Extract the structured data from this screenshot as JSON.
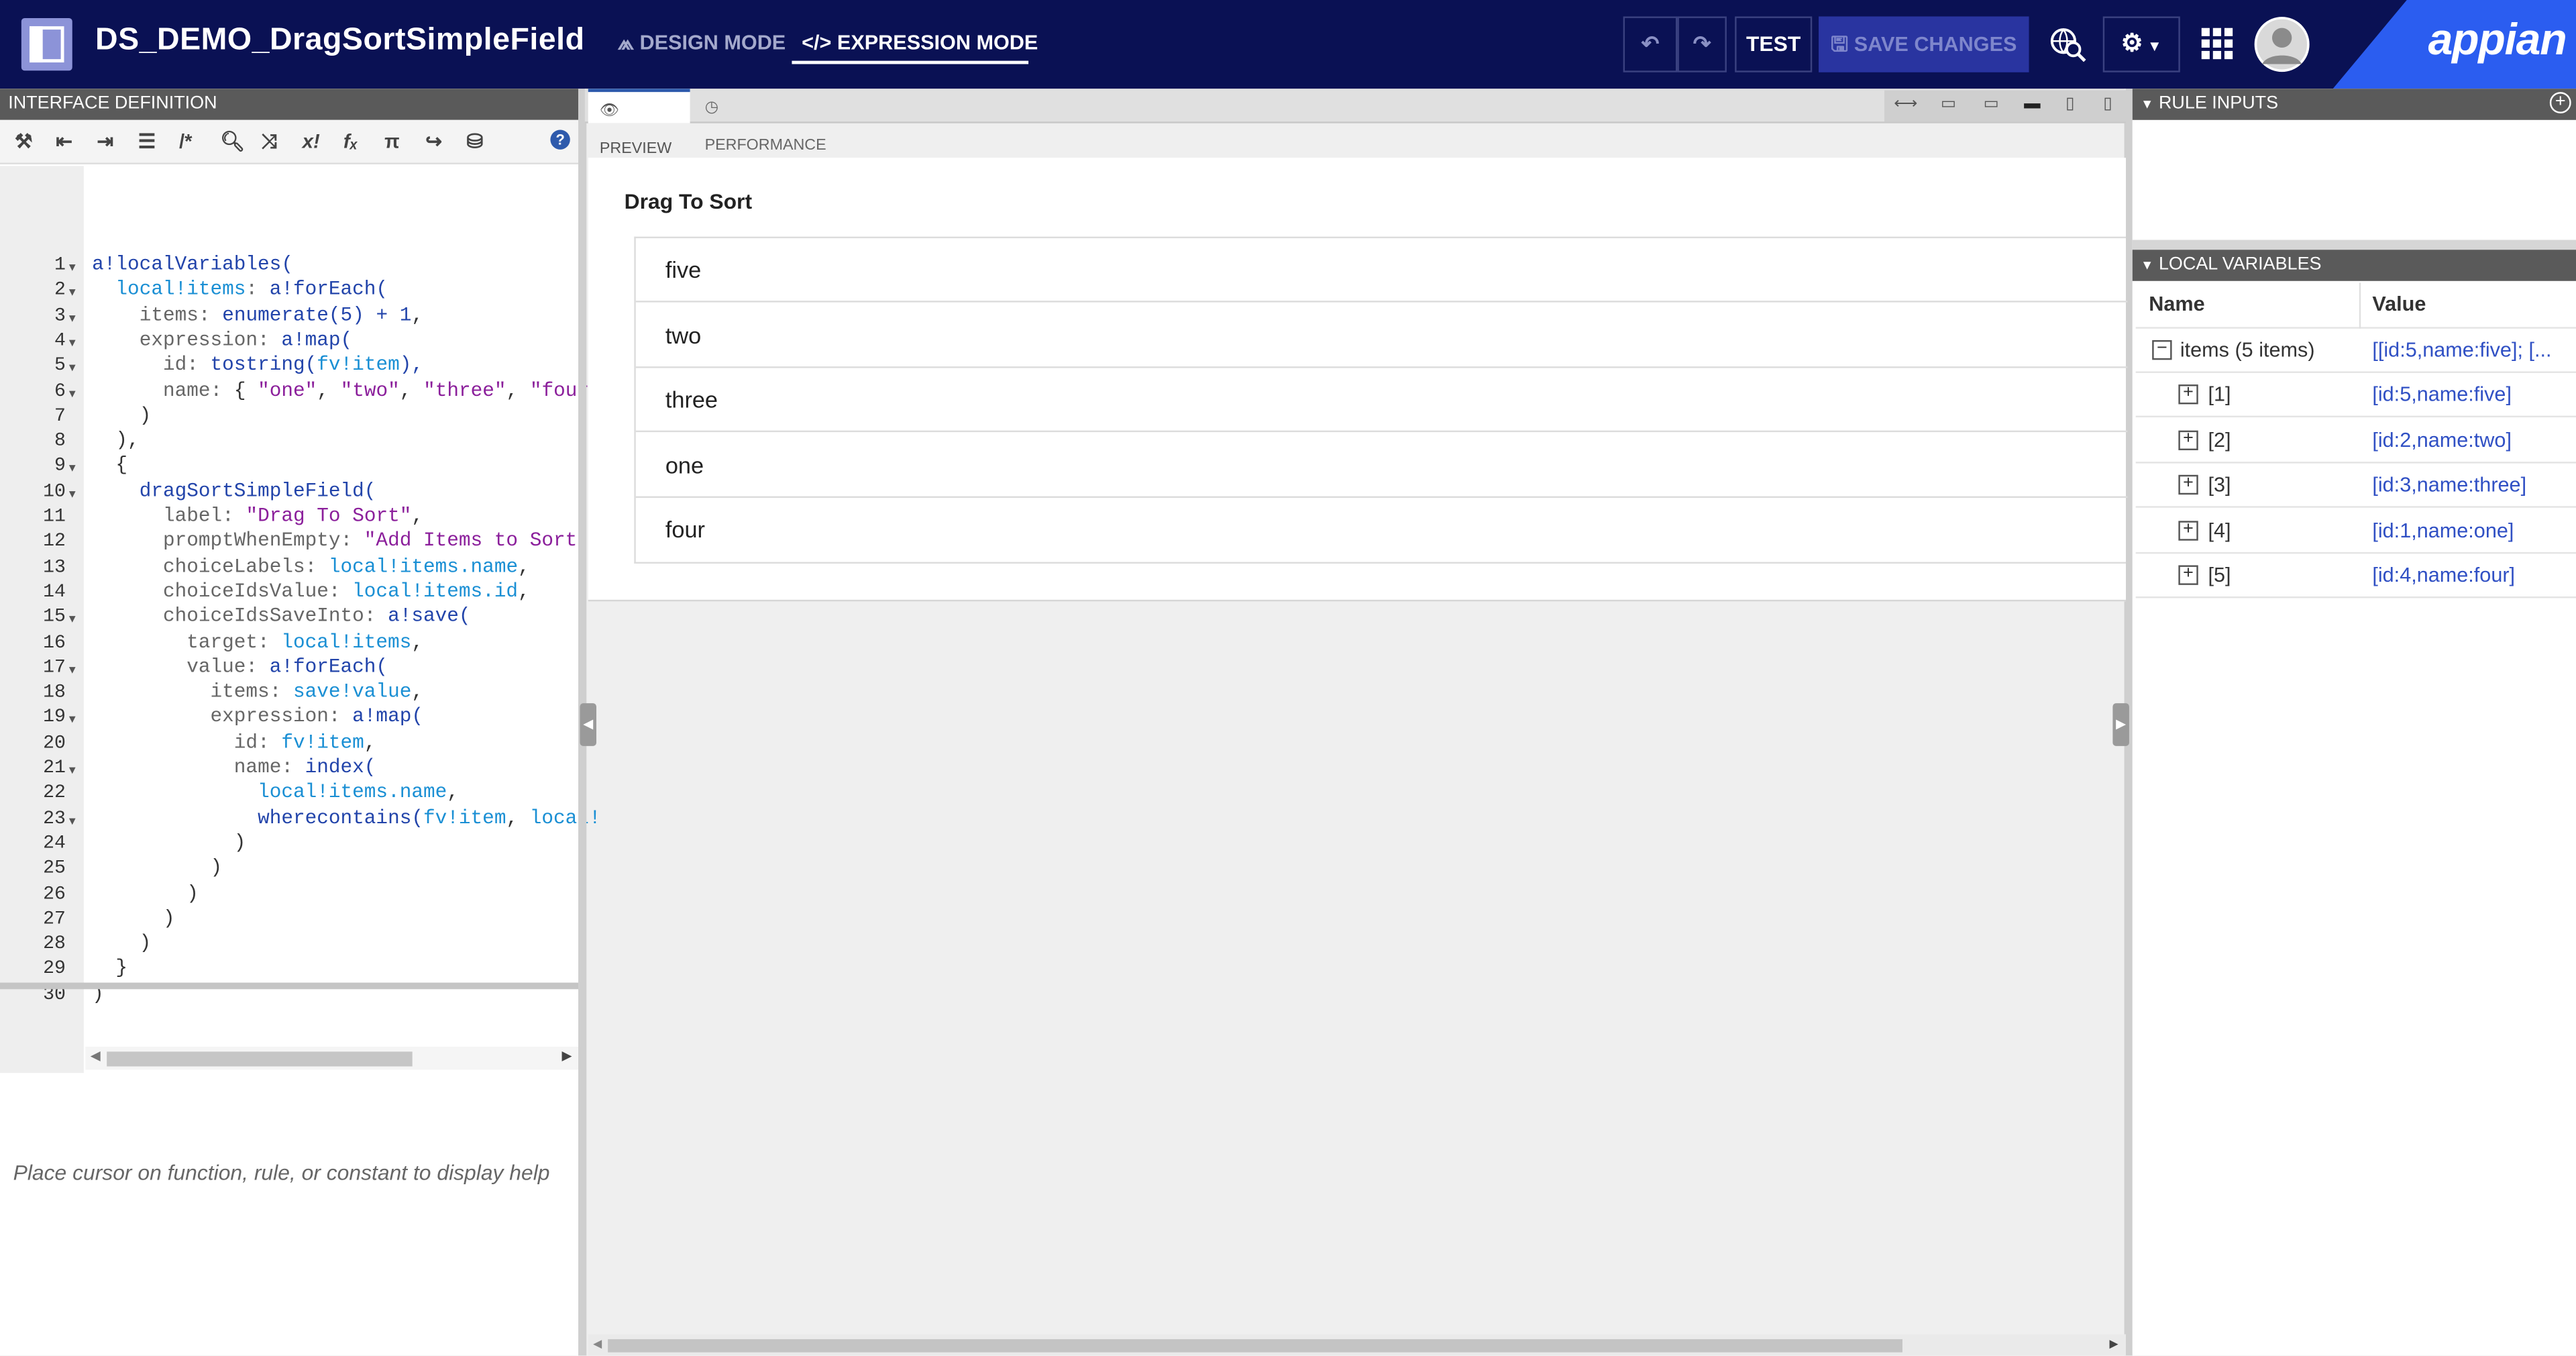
{
  "header": {
    "app_title": "DS_DEMO_DragSortSimpleField",
    "design_mode_label": "DESIGN MODE",
    "expression_mode_label": "EXPRESSION MODE",
    "test_label": "TEST",
    "save_label": "SAVE CHANGES",
    "brand": "appian",
    "colors": {
      "header_bg": "#0a1154",
      "brand_band": "#2b5df0",
      "save_disabled": "#2934a0"
    }
  },
  "left_panel": {
    "title": "INTERFACE DEFINITION",
    "toolbar_icons": [
      "format-icon",
      "outdent-icon",
      "indent-icon",
      "list-icon",
      "comment-icon",
      "search-icon",
      "shuffle-icon",
      "variable-icon",
      "function-icon",
      "constant-icon",
      "export-icon",
      "database-icon",
      "help-icon"
    ],
    "help_text": "Place cursor on function, rule, or constant to display help",
    "line_numbers": [
      "1",
      "2",
      "3",
      "4",
      "5",
      "6",
      "7",
      "8",
      "9",
      "10",
      "11",
      "12",
      "13",
      "14",
      "15",
      "16",
      "17",
      "18",
      "19",
      "20",
      "21",
      "22",
      "23",
      "24",
      "25",
      "26",
      "27",
      "28",
      "29",
      "30"
    ],
    "code_lines": [
      [
        [
          "fn",
          "a!localVariables("
        ]
      ],
      [
        [
          "plain",
          "  "
        ],
        [
          "var",
          "local!items"
        ],
        [
          "prm",
          ": "
        ],
        [
          "fn",
          "a!forEach("
        ]
      ],
      [
        [
          "plain",
          "    "
        ],
        [
          "prm",
          "items: "
        ],
        [
          "fn",
          "enumerate("
        ],
        [
          "num",
          "5"
        ],
        [
          "fn",
          ") + "
        ],
        [
          "num",
          "1"
        ],
        [
          "plain",
          ","
        ]
      ],
      [
        [
          "plain",
          "    "
        ],
        [
          "prm",
          "expression: "
        ],
        [
          "fn",
          "a!map("
        ]
      ],
      [
        [
          "plain",
          "      "
        ],
        [
          "prm",
          "id: "
        ],
        [
          "fn",
          "tostring("
        ],
        [
          "var",
          "fv!item"
        ],
        [
          "fn",
          "),"
        ]
      ],
      [
        [
          "plain",
          "      "
        ],
        [
          "prm",
          "name: "
        ],
        [
          "plain",
          "{ "
        ],
        [
          "str",
          "\"one\""
        ],
        [
          "plain",
          ", "
        ],
        [
          "str",
          "\"two\""
        ],
        [
          "plain",
          ", "
        ],
        [
          "str",
          "\"three\""
        ],
        [
          "plain",
          ", "
        ],
        [
          "str",
          "\"four\""
        ]
      ],
      [
        [
          "plain",
          "    )"
        ]
      ],
      [
        [
          "plain",
          "  ),"
        ]
      ],
      [
        [
          "plain",
          "  {"
        ]
      ],
      [
        [
          "plain",
          "    "
        ],
        [
          "fn",
          "dragSortSimpleField("
        ]
      ],
      [
        [
          "plain",
          "      "
        ],
        [
          "prm",
          "label: "
        ],
        [
          "str",
          "\"Drag To Sort\""
        ],
        [
          "plain",
          ","
        ]
      ],
      [
        [
          "plain",
          "      "
        ],
        [
          "prm",
          "promptWhenEmpty: "
        ],
        [
          "str",
          "\"Add Items to Sort\""
        ],
        [
          "plain",
          ","
        ]
      ],
      [
        [
          "plain",
          "      "
        ],
        [
          "prm",
          "choiceLabels: "
        ],
        [
          "var",
          "local!items.name"
        ],
        [
          "plain",
          ","
        ]
      ],
      [
        [
          "plain",
          "      "
        ],
        [
          "prm",
          "choiceIdsValue: "
        ],
        [
          "var",
          "local!items.id"
        ],
        [
          "plain",
          ","
        ]
      ],
      [
        [
          "plain",
          "      "
        ],
        [
          "prm",
          "choiceIdsSaveInto: "
        ],
        [
          "fn",
          "a!save("
        ]
      ],
      [
        [
          "plain",
          "        "
        ],
        [
          "prm",
          "target: "
        ],
        [
          "var",
          "local!items"
        ],
        [
          "plain",
          ","
        ]
      ],
      [
        [
          "plain",
          "        "
        ],
        [
          "prm",
          "value: "
        ],
        [
          "fn",
          "a!forEach("
        ]
      ],
      [
        [
          "plain",
          "          "
        ],
        [
          "prm",
          "items: "
        ],
        [
          "var",
          "save!value"
        ],
        [
          "plain",
          ","
        ]
      ],
      [
        [
          "plain",
          "          "
        ],
        [
          "prm",
          "expression: "
        ],
        [
          "fn",
          "a!map("
        ]
      ],
      [
        [
          "plain",
          "            "
        ],
        [
          "prm",
          "id: "
        ],
        [
          "var",
          "fv!item"
        ],
        [
          "plain",
          ","
        ]
      ],
      [
        [
          "plain",
          "            "
        ],
        [
          "prm",
          "name: "
        ],
        [
          "fn",
          "index("
        ]
      ],
      [
        [
          "plain",
          "              "
        ],
        [
          "var",
          "local!items.name"
        ],
        [
          "plain",
          ","
        ]
      ],
      [
        [
          "plain",
          "              "
        ],
        [
          "fn",
          "wherecontains("
        ],
        [
          "var",
          "fv!item"
        ],
        [
          "plain",
          ", "
        ],
        [
          "var",
          "local!"
        ]
      ],
      [
        [
          "plain",
          "            )"
        ]
      ],
      [
        [
          "plain",
          "          )"
        ]
      ],
      [
        [
          "plain",
          "        )"
        ]
      ],
      [
        [
          "plain",
          "      )"
        ]
      ],
      [
        [
          "plain",
          "    )"
        ]
      ],
      [
        [
          "plain",
          "  }"
        ]
      ],
      [
        [
          "plain",
          ")"
        ]
      ]
    ]
  },
  "center": {
    "tab_preview": "PREVIEW",
    "tab_performance": "PERFORMANCE",
    "field_label": "Drag To Sort",
    "sort_items": [
      "five",
      "two",
      "three",
      "one",
      "four"
    ]
  },
  "right_panel": {
    "rule_inputs_title": "RULE INPUTS",
    "local_variables_title": "LOCAL VARIABLES",
    "col_name": "Name",
    "col_value": "Value",
    "root": {
      "name": "items (5 items)",
      "value": "[[id:5,name:five]; [..."
    },
    "children": [
      {
        "name": "[1]",
        "value": "[id:5,name:five]"
      },
      {
        "name": "[2]",
        "value": "[id:2,name:two]"
      },
      {
        "name": "[3]",
        "value": "[id:3,name:three]"
      },
      {
        "name": "[4]",
        "value": "[id:1,name:one]"
      },
      {
        "name": "[5]",
        "value": "[id:4,name:four]"
      }
    ]
  }
}
